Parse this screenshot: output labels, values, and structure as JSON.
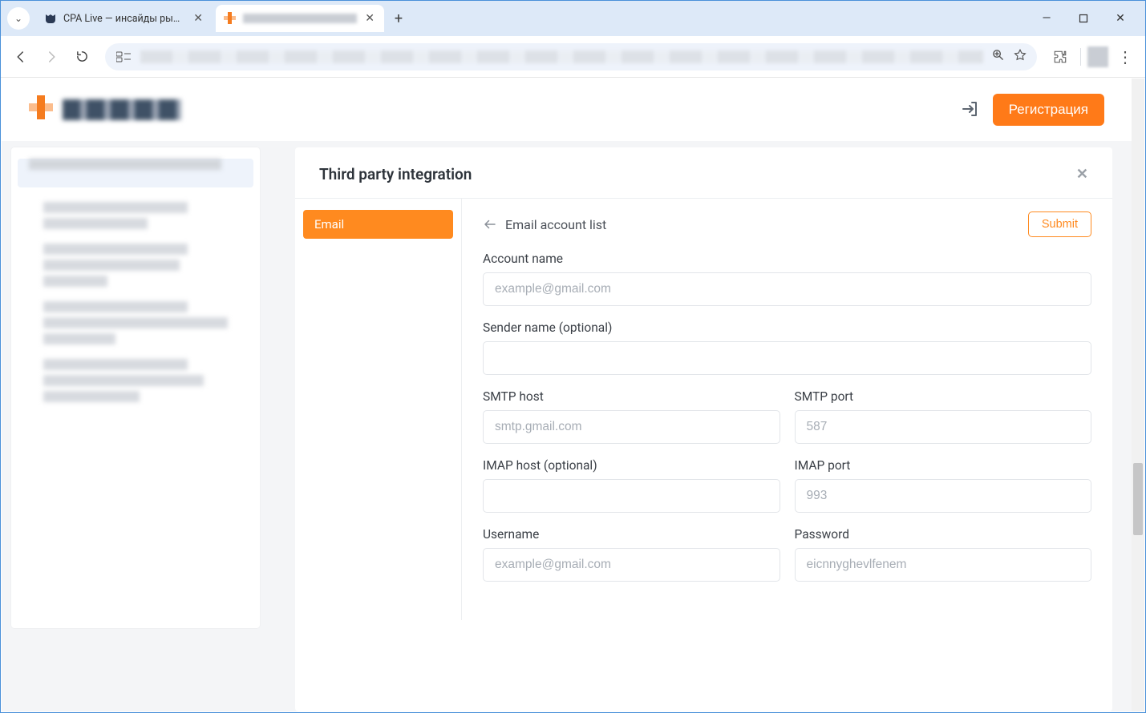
{
  "browser": {
    "tabs": [
      {
        "title": "CPA Live — инсайды рынка",
        "active": false
      },
      {
        "title": "",
        "active": true
      }
    ],
    "newTab": "+",
    "tabDropdown": "⌄",
    "windowControls": {
      "min": "—",
      "max": "▢",
      "close": "✕"
    },
    "nav": {
      "back": "←",
      "forward": "→",
      "reload": "⟳"
    },
    "addrSiteBtn": "⚙",
    "zoomIcon": "zoom-icon",
    "starIcon": "star-icon",
    "extIcon": "puzzle-icon",
    "menuIcon": "⋮"
  },
  "header": {
    "registerLabel": "Регистрация",
    "loginIcon": "login-icon"
  },
  "panel": {
    "title": "Third party integration",
    "closeGlyph": "✕",
    "tabs": {
      "email": "Email"
    },
    "backLabel": "Email account list",
    "submitLabel": "Submit"
  },
  "form": {
    "accountName": {
      "label": "Account name",
      "placeholder": "example@gmail.com",
      "value": ""
    },
    "senderName": {
      "label": "Sender name (optional)",
      "placeholder": "",
      "value": ""
    },
    "smtpHost": {
      "label": "SMTP host",
      "placeholder": "smtp.gmail.com",
      "value": ""
    },
    "smtpPort": {
      "label": "SMTP port",
      "placeholder": "587",
      "value": ""
    },
    "imapHost": {
      "label": "IMAP host (optional)",
      "placeholder": "",
      "value": ""
    },
    "imapPort": {
      "label": "IMAP port",
      "placeholder": "993",
      "value": ""
    },
    "username": {
      "label": "Username",
      "placeholder": "example@gmail.com",
      "value": ""
    },
    "password": {
      "label": "Password",
      "placeholder": "eicnnyghevlfenem",
      "value": ""
    }
  }
}
